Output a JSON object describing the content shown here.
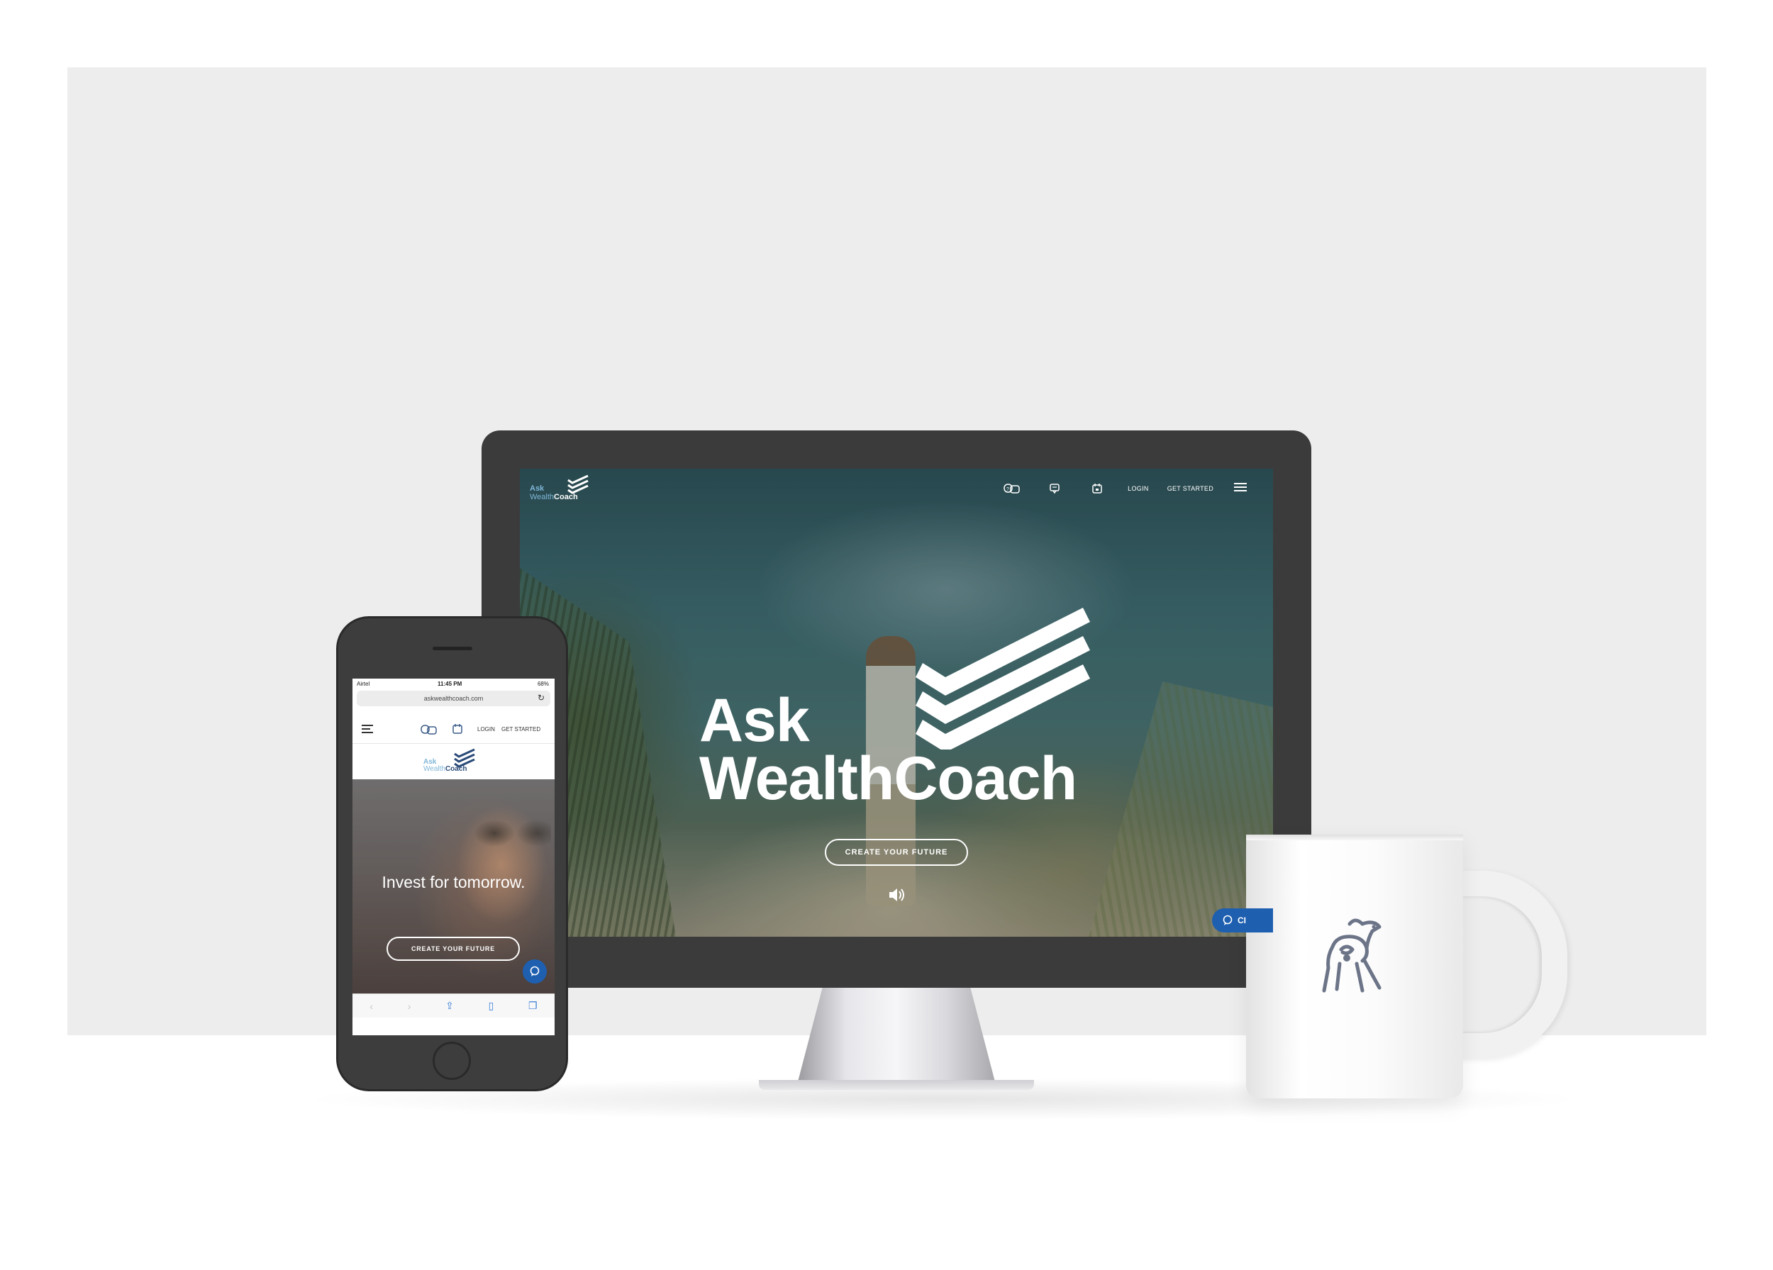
{
  "brand": {
    "name_line1": "Ask",
    "name_line2_a": "Wealth",
    "name_line2_b": "Coach",
    "accent_light": "#7fb6d8",
    "accent_dark": "#2a4a78",
    "chat_blue": "#1e5fb0"
  },
  "desktop": {
    "nav": {
      "icons": [
        "video-chat-icon",
        "message-icon",
        "calendar-icon"
      ],
      "login": "LOGIN",
      "get_started": "GET STARTED",
      "menu_icon": "hamburger-icon"
    },
    "hero": {
      "title_line1": "Ask",
      "title_line2": "WealthCoach",
      "cta": "CREATE YOUR FUTURE",
      "sound_icon": "speaker-icon",
      "chat_label": "CI"
    }
  },
  "mobile": {
    "status": {
      "carrier": "Airtel",
      "time": "11:45 PM",
      "battery": "68%"
    },
    "url": "askwealthcoach.com",
    "nav": {
      "login": "LOGIN",
      "get_started": "GET STARTED"
    },
    "hero": {
      "headline": "Invest for tomorrow.",
      "cta": "CREATE YOUR FUTURE"
    },
    "toolbar": [
      "back-icon",
      "forward-icon",
      "share-icon",
      "bookmarks-icon",
      "tabs-icon"
    ]
  },
  "mug": {
    "logo_icon": "horse-emblem-icon"
  }
}
